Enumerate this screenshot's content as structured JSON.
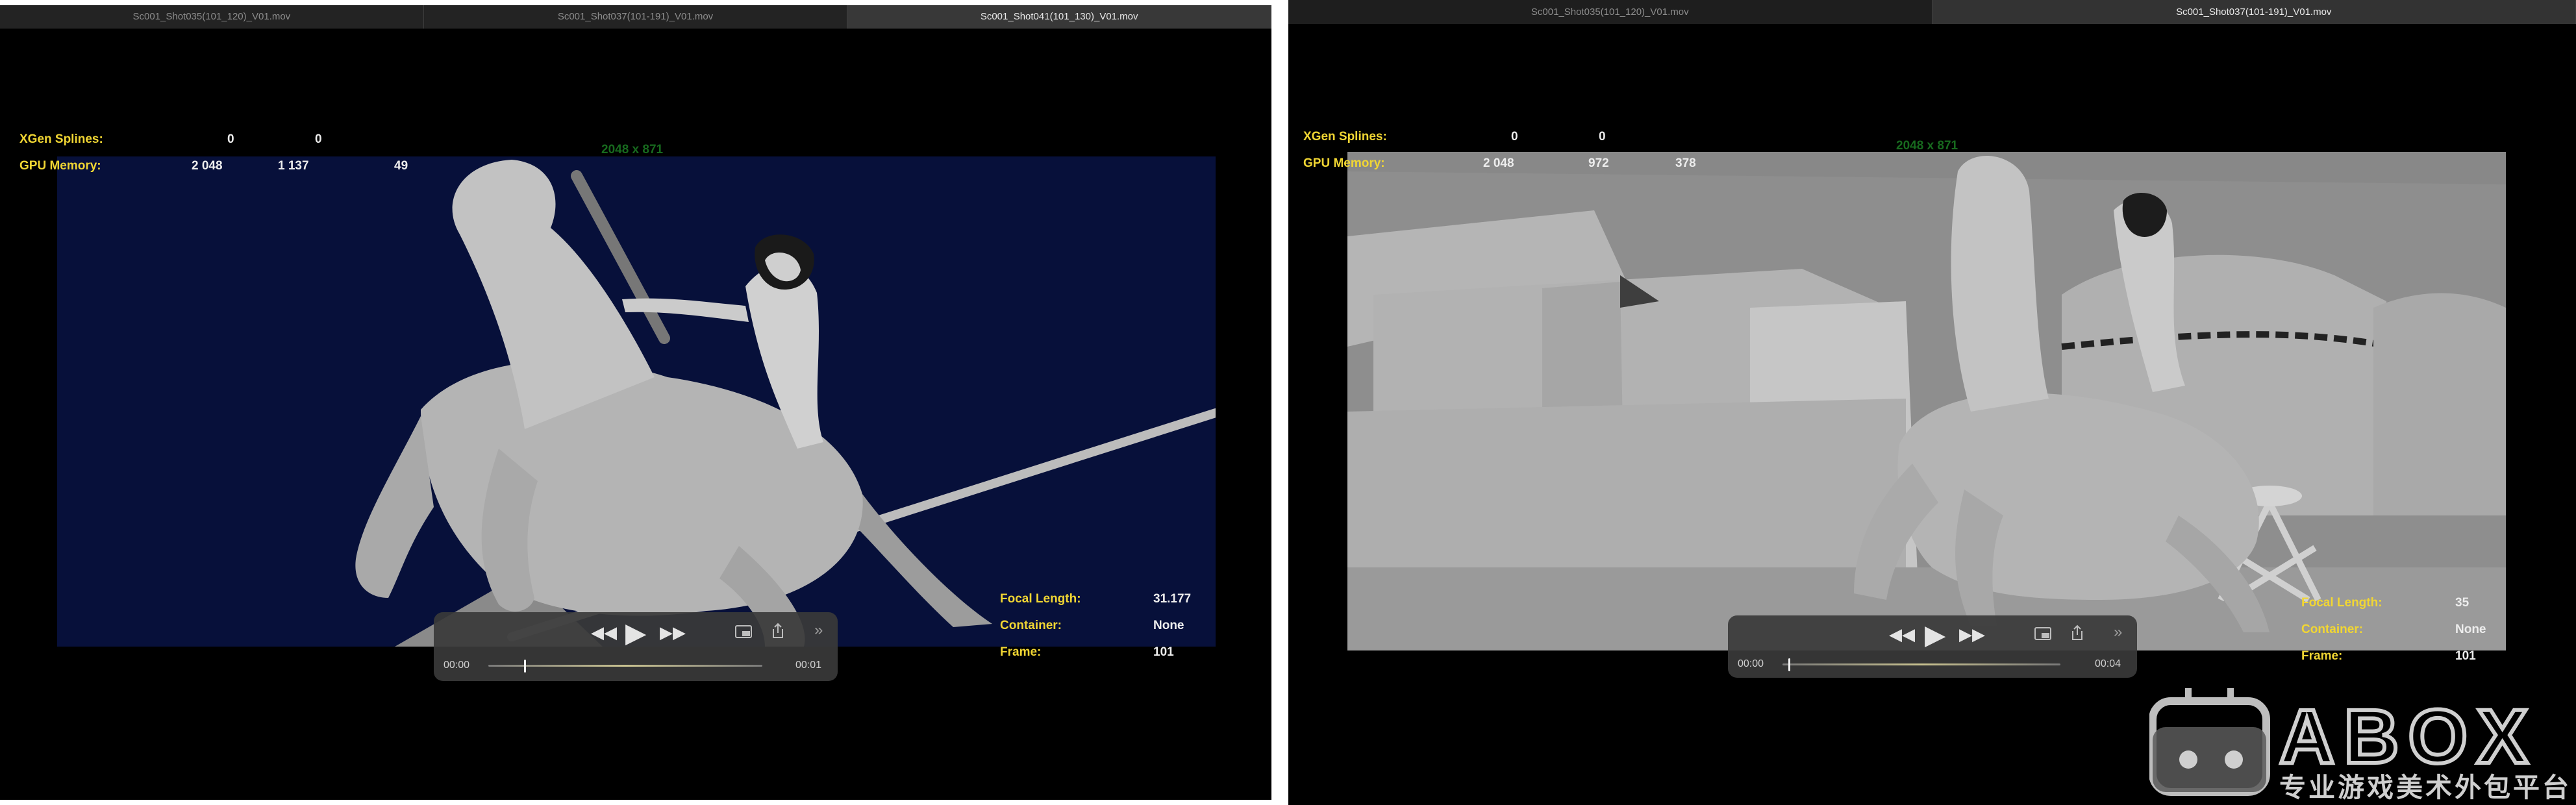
{
  "left_panel": {
    "tabs": [
      "Sc001_Shot035(101_120)_V01.mov",
      "Sc001_Shot037(101-191)_V01.mov",
      "Sc001_Shot041(101_130)_V01.mov"
    ],
    "active_tab": 2,
    "hud": {
      "xgen_label": "XGen Splines:",
      "xgen_v1": "0",
      "xgen_v2": "0",
      "gpu_label": "GPU Memory:",
      "gpu_v1": "2 048",
      "gpu_v2": "1 137",
      "gpu_v3": "49",
      "resolution": "2048 x 871",
      "focal_label": "Focal Length:",
      "focal_value": "31.177",
      "container_label": "Container:",
      "container_value": "None",
      "frame_label": "Frame:",
      "frame_value": "101"
    },
    "player": {
      "time_start": "00:00",
      "time_end": "00:01",
      "progress": 0.13
    }
  },
  "right_panel": {
    "tabs": [
      "Sc001_Shot035(101_120)_V01.mov",
      "Sc001_Shot037(101-191)_V01.mov"
    ],
    "active_tab": 1,
    "hud": {
      "xgen_label": "XGen Splines:",
      "xgen_v1": "0",
      "xgen_v2": "0",
      "gpu_label": "GPU Memory:",
      "gpu_v1": "2 048",
      "gpu_v2": "972",
      "gpu_v3": "378",
      "resolution": "2048 x 871",
      "focal_label": "Focal Length:",
      "focal_value": "35",
      "container_label": "Container:",
      "container_value": "None",
      "frame_label": "Frame:",
      "frame_value": "101"
    },
    "player": {
      "time_start": "00:00",
      "time_end": "00:04",
      "progress": 0.02
    }
  },
  "icons": {
    "rewind": "rewind-icon",
    "play": "play-icon",
    "fast_forward": "fast-forward-icon",
    "pip": "picture-in-picture-icon",
    "share": "share-icon",
    "more": "more-chevron-icon"
  },
  "colors": {
    "hud_label": "#f1d633",
    "hud_value": "#ededed",
    "resolution": "#176a1e",
    "left_bg": "#07103a",
    "right_bg": "#8e8e8e"
  },
  "watermark": {
    "brand": "ABOX",
    "tagline": "专业游戏美术外包平台"
  }
}
